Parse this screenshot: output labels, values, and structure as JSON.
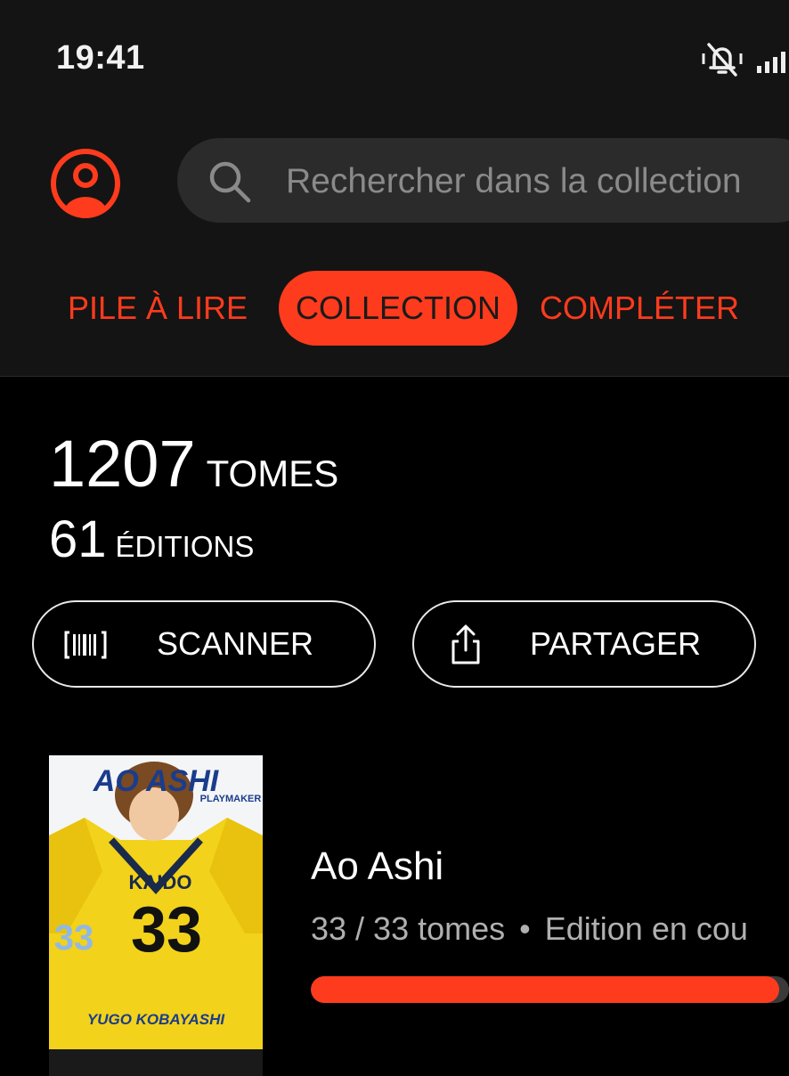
{
  "status_bar": {
    "time": "19:41"
  },
  "header": {
    "search": {
      "placeholder": "Rechercher dans la collection",
      "value": ""
    },
    "tabs": [
      {
        "label": "PILE À LIRE",
        "active": false
      },
      {
        "label": "COLLECTION",
        "active": true
      },
      {
        "label": "COMPLÉTER",
        "active": false
      }
    ]
  },
  "summary": {
    "tomes_count": "1207",
    "tomes_label": "TOMES",
    "editions_count": "61",
    "editions_label": "ÉDITIONS"
  },
  "actions": {
    "scan_label": "SCANNER",
    "share_label": "PARTAGER"
  },
  "collection": [
    {
      "title": "Ao Ashi",
      "volumes": "33 / 33 tomes",
      "status": "Edition en cou",
      "progress": 0.98,
      "cover_text": {
        "logo": "AO ASHI",
        "subtitle": "PLAYMAKER",
        "name": "KAIDO",
        "number": "33",
        "author": "YUGO KOBAYASHI"
      }
    }
  ],
  "icons": {
    "profile": "profile-icon",
    "search": "search-icon",
    "silent": "bell-off-icon",
    "signal": "signal-icon",
    "barcode": "barcode-icon",
    "share": "share-icon"
  },
  "colors": {
    "accent": "#ff3b1d",
    "header_bg": "#141414",
    "page_bg": "#000000",
    "search_bg": "#2b2b2b",
    "muted_text": "#b0b0b0"
  }
}
